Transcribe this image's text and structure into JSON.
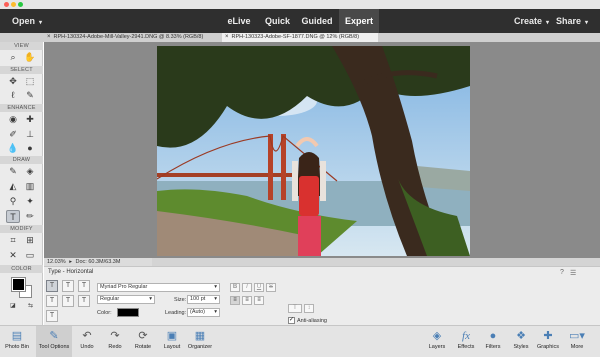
{
  "menubar": {
    "open": "Open",
    "modes": [
      "eLive",
      "Quick",
      "Guided",
      "Expert"
    ],
    "create": "Create",
    "share": "Share"
  },
  "tabs": [
    "RPH-130324-Adobe-Mill-Valley-2941.DNG @ 8.33% (RGB/8)",
    "RPH-130323-Adobe-SF-1877.DNG @ 12% (RGB/8)"
  ],
  "toolbox": {
    "sections": [
      "VIEW",
      "SELECT",
      "ENHANCE",
      "DRAW",
      "MODIFY",
      "COLOR"
    ]
  },
  "status": {
    "zoom": "12.03%",
    "doc": "Doc: 60.3M/63.3M"
  },
  "options": {
    "tool_name": "Type - Horizontal",
    "font_family": "Myriad Pro Regular",
    "font_style": "Regular",
    "size_label": "Size:",
    "size_value": "100 pt",
    "color_label": "Color:",
    "leading_label": "Leading:",
    "leading_value": "(Auto)",
    "style_buttons": [
      "B",
      "I",
      "U",
      "S"
    ],
    "anti_aliasing": "Anti-aliasing",
    "anti_aliasing_checked": true,
    "text_color": "#000000"
  },
  "bottom_bar": {
    "left": [
      "Photo Bin",
      "Tool Options",
      "Undo",
      "Redo",
      "Rotate",
      "Layout",
      "Organizer"
    ],
    "right": [
      "Layers",
      "Effects",
      "Filters",
      "Styles",
      "Graphics",
      "More"
    ]
  },
  "colors": {
    "menubar_bg": "#2f2f2f",
    "active_mode_bg": "#494949",
    "canvas_bg": "#8a8a8a",
    "icon_blue": "#4b7fb5"
  }
}
